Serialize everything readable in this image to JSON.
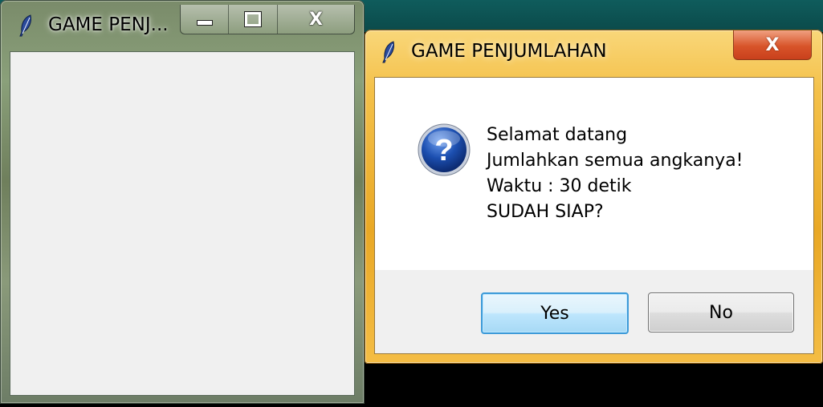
{
  "main_window": {
    "title": "GAME PENJ...",
    "minimize_glyph": "—",
    "maximize_glyph": "▣",
    "close_glyph": "X"
  },
  "dialog": {
    "title": "GAME PENJUMLAHAN",
    "close_glyph": "X",
    "icon": "question-icon",
    "message_lines": [
      "Selamat datang",
      "Jumlahkan semua angkanya!",
      "Waktu : 30 detik",
      "SUDAH SIAP?"
    ],
    "yes_label": "Yes",
    "no_label": "No"
  },
  "colors": {
    "dialog_frame": "#f4c14a",
    "main_frame": "#7a8b6a",
    "client_bg": "#f0f0f0",
    "default_button_border": "#3c9ad8",
    "question_icon_blue": "#1c4fb0"
  }
}
